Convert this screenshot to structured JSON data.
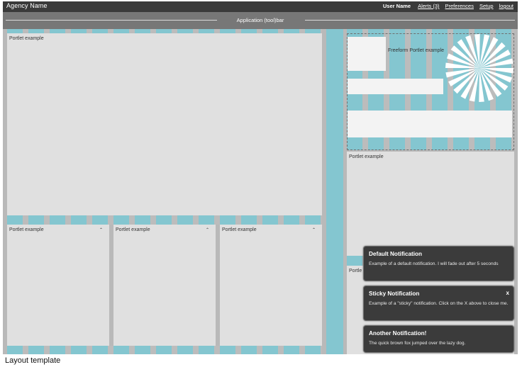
{
  "header": {
    "agency_name": "Agency Name",
    "user_name": "User Name",
    "alerts_link": "Alerts (3)",
    "preferences_link": "Preferences",
    "setup_link": "Setup",
    "logout_link": "logout"
  },
  "toolbar": {
    "label": "Application (tool)bar"
  },
  "portlets": {
    "main": "Portlet example",
    "bottom_left": "Portlet example",
    "bottom_middle": "Portlet example",
    "bottom_right": "Portlet example",
    "right_middle": "Portlet example",
    "right_lower": "Portle"
  },
  "freeform": {
    "label": "Freeform Portlet example"
  },
  "icons": {
    "collapse": "double-chevron-up-icon",
    "close": "close-icon",
    "sunburst": "sunburst-graphic"
  },
  "collapse_glyph": "⌃",
  "notifications": [
    {
      "title": "Default Notification",
      "body": "Example of a default notification. I will fade out after 5 seconds"
    },
    {
      "title": "Sticky Notification",
      "body": "Example of a \"sticky\" notification. Click on the X above to close me.",
      "close": "x"
    },
    {
      "title": "Another Notification!",
      "body": "The quick brown fox jumped over the lazy dog."
    }
  ],
  "caption": "Layout template",
  "colors": {
    "accent": "#84c6d0",
    "topbar": "#3a3a3a",
    "toolbar": "#777777",
    "portlet": "#e0e0e0",
    "notification": "#3b3b3b"
  }
}
